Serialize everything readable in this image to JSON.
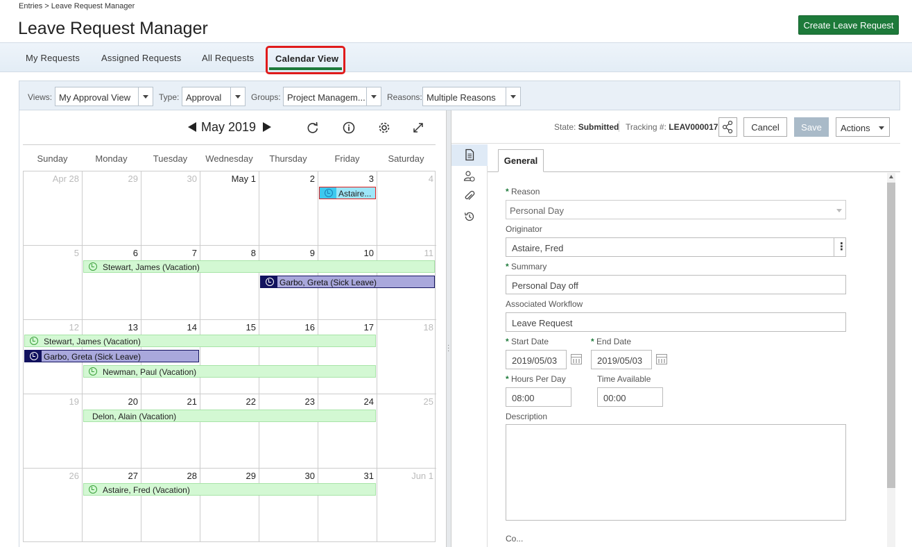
{
  "breadcrumb": "Entries > Leave Request Manager",
  "page_title": "Leave Request Manager",
  "create_button": "Create Leave Request",
  "tabs": [
    {
      "label": "My Requests"
    },
    {
      "label": "Assigned Requests"
    },
    {
      "label": "All Requests"
    },
    {
      "label": "Calendar View"
    }
  ],
  "filters": {
    "views_label": "Views:",
    "views_value": "My Approval View",
    "type_label": "Type:",
    "type_value": "Approval",
    "groups_label": "Groups:",
    "groups_value": "Project Managem...",
    "reasons_label": "Reasons:",
    "reasons_value": "Multiple Reasons"
  },
  "calendar": {
    "month": "May 2019",
    "days": [
      "Sunday",
      "Monday",
      "Tuesday",
      "Wednesday",
      "Thursday",
      "Friday",
      "Saturday"
    ],
    "weeks": [
      [
        "Apr 28",
        "29",
        "30",
        "May 1",
        "2",
        "3",
        "4"
      ],
      [
        "5",
        "6",
        "7",
        "8",
        "9",
        "10",
        "11"
      ],
      [
        "12",
        "13",
        "14",
        "15",
        "16",
        "17",
        "18"
      ],
      [
        "19",
        "20",
        "21",
        "22",
        "23",
        "24",
        "25"
      ],
      [
        "26",
        "27",
        "28",
        "29",
        "30",
        "31",
        "Jun 1"
      ]
    ],
    "events": [
      {
        "label": "Astaire...",
        "color": "#9ee6f8"
      },
      {
        "label": "Stewart, James (Vacation)",
        "color": "#d3f8d3"
      },
      {
        "label": "Garbo, Greta (Sick Leave)",
        "color": "#a9a8dc"
      },
      {
        "label": "Stewart, James (Vacation)",
        "color": "#d3f8d3"
      },
      {
        "label": "Garbo, Greta (Sick Leave)",
        "color": "#a9a8dc"
      },
      {
        "label": "Newman, Paul (Vacation)",
        "color": "#d3f8d3"
      },
      {
        "label": "Delon, Alain (Vacation)",
        "color": "#d3f8d3"
      },
      {
        "label": "Astaire, Fred (Vacation)",
        "color": "#d3f8d3"
      }
    ]
  },
  "record": {
    "state_label": "State:",
    "state_value": "Submitted",
    "tracking_label": "Tracking #:",
    "tracking_value": "LEAV000017",
    "cancel": "Cancel",
    "save": "Save",
    "actions": "Actions",
    "tab_general": "General"
  },
  "form": {
    "reason_label": "Reason",
    "reason_value": "Personal Day",
    "originator_label": "Originator",
    "originator_value": "Astaire, Fred",
    "summary_label": "Summary",
    "summary_value": "Personal Day off",
    "workflow_label": "Associated Workflow",
    "workflow_value": "Leave Request",
    "start_label": "Start Date",
    "start_value": "2019/05/03",
    "end_label": "End Date",
    "end_value": "2019/05/03",
    "hours_label": "Hours Per Day",
    "hours_value": "08:00",
    "time_label": "Time Available",
    "time_value": "00:00",
    "description_label": "Description",
    "co_label": "Co..."
  },
  "colors": {
    "accent": "#1d7a3a",
    "highlight": "#e01b1b"
  }
}
